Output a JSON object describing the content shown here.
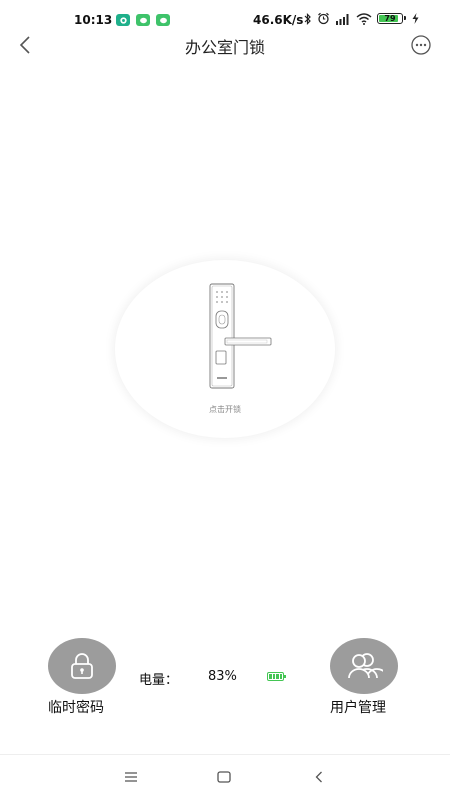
{
  "status_bar": {
    "time": "10:13",
    "net_speed": "46.6K/s",
    "battery_level": "79",
    "battery_fraction": 0.79,
    "app_icons": [
      "chat-app-icon",
      "wechat-icon",
      "wechat-icon"
    ],
    "system_icons": [
      "bluetooth-icon",
      "alarm-icon",
      "cell-signal-icon",
      "wifi-icon",
      "battery-icon",
      "charging-icon"
    ]
  },
  "header": {
    "title": "办公室门锁",
    "back_icon": "chevron-left-icon",
    "more_icon": "more-dots-icon"
  },
  "lock_panel": {
    "hint": "点击开锁"
  },
  "controls": {
    "temp_password_label": "临时密码",
    "user_management_label": "用户管理",
    "power_label": "电量：",
    "power_value": "83%",
    "power_fraction": 0.83
  },
  "nav": {
    "menu_icon": "menu-icon",
    "home_icon": "home-icon",
    "back_icon": "back-icon"
  },
  "colors": {
    "accent_green": "#43c553",
    "button_gray": "#9c9c9c"
  }
}
